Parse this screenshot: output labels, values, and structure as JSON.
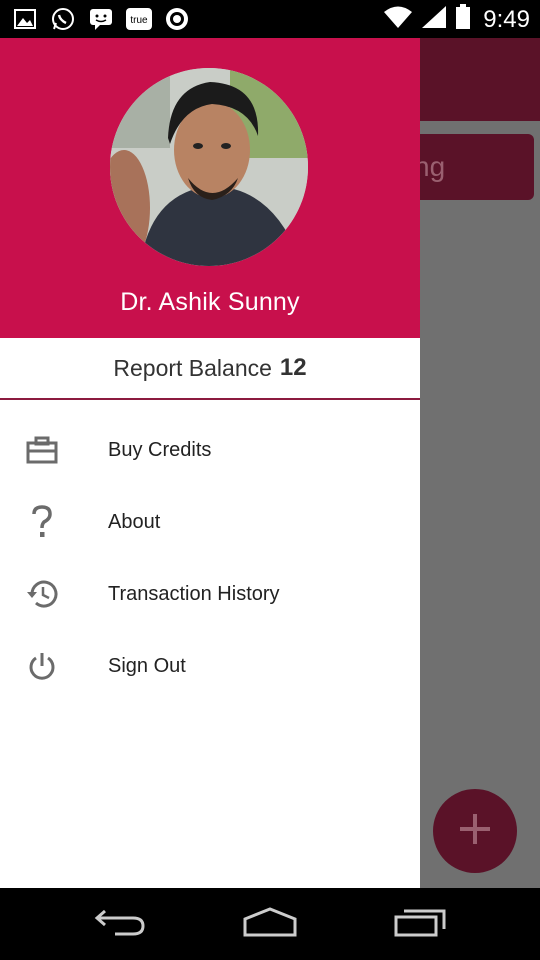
{
  "status_bar": {
    "time": "9:49",
    "left_icons": [
      "image-icon",
      "whatsapp-icon",
      "messenger-icon",
      "truecaller-icon",
      "record-icon"
    ],
    "right_icons": [
      "wifi-icon",
      "signal-icon",
      "battery-icon"
    ],
    "true_label": "true"
  },
  "background_app": {
    "field_text": "ng",
    "fab_icon": "plus-icon"
  },
  "drawer": {
    "user_name": "Dr. Ashik Sunny",
    "balance_label": "Report Balance",
    "balance_value": "12",
    "menu": [
      {
        "label": "Buy Credits",
        "icon": "briefcase-icon"
      },
      {
        "label": "About",
        "icon": "question-icon"
      },
      {
        "label": "Transaction History",
        "icon": "history-icon"
      },
      {
        "label": "Sign Out",
        "icon": "power-icon"
      }
    ]
  },
  "nav_bar": {
    "icons": [
      "back-icon",
      "home-icon",
      "recents-icon"
    ]
  },
  "colors": {
    "header": "#c8104c",
    "accent_dark": "#5a1228",
    "divider": "#8c1a3f"
  }
}
